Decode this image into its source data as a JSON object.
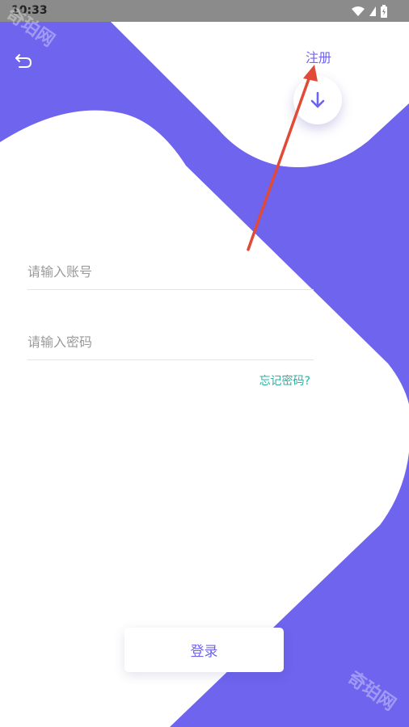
{
  "status_bar": {
    "time": "10:33"
  },
  "header": {
    "back_icon": "undo-arrow-icon",
    "register_label": "注册"
  },
  "fab": {
    "icon": "arrow-down-icon"
  },
  "form": {
    "account_placeholder": "请输入账号",
    "password_placeholder": "请输入密码",
    "forgot_label": "忘记密码?"
  },
  "login": {
    "label": "登录"
  },
  "watermark": {
    "text": "奇珀网"
  },
  "colors": {
    "accent": "#6e64ee",
    "link_teal": "#27b3a4",
    "status_bar": "#8b8b8b",
    "annotation_arrow": "#e04a36"
  }
}
